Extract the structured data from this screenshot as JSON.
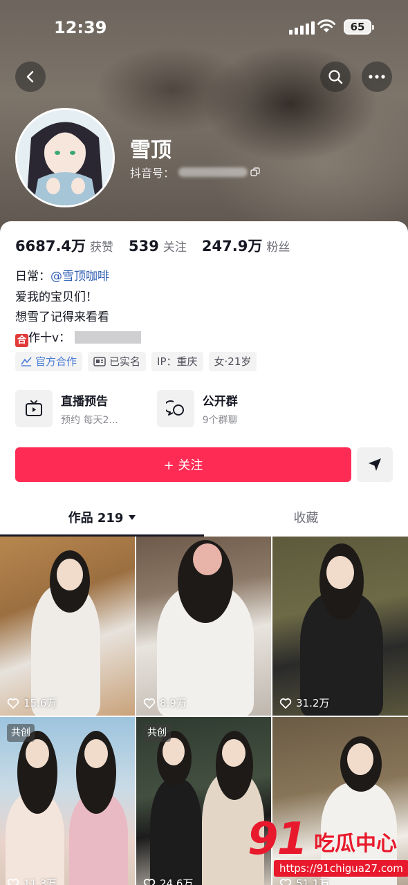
{
  "status_bar": {
    "time": "12:39",
    "battery": "65"
  },
  "profile": {
    "username": "雪顶",
    "douyin_id_label": "抖音号："
  },
  "stats": [
    {
      "num": "6687.4万",
      "label": "获赞"
    },
    {
      "num": "539",
      "label": "关注"
    },
    {
      "num": "247.9万",
      "label": "粉丝"
    }
  ],
  "bio": {
    "line1_prefix": "日常：",
    "line1_mention": "@雪顶咖啡",
    "line2": "爱我的宝贝们！",
    "line3": "想雪了记得来看看",
    "line4_badge": "合",
    "line4_text": "作十v："
  },
  "tags": [
    {
      "label": "官方合作",
      "icon": "official-partner-icon"
    },
    {
      "label": "已实名",
      "icon": "id-card-icon"
    },
    {
      "label": "IP：重庆"
    },
    {
      "label": "女·21岁"
    }
  ],
  "features": [
    {
      "title": "直播预告",
      "sub": "预约 每天2...",
      "icon": "tv-icon"
    },
    {
      "title": "公开群",
      "sub": "9个群聊",
      "icon": "chat-bubbles-icon"
    }
  ],
  "actions": {
    "follow": "+ 关注"
  },
  "tabs": {
    "works": "作品 219",
    "favorites": "收藏"
  },
  "videos": [
    {
      "likes": "15.6万",
      "cocreate": ""
    },
    {
      "likes": "8.9万",
      "cocreate": ""
    },
    {
      "likes": "31.2万",
      "cocreate": ""
    },
    {
      "likes": "11.3万",
      "cocreate": "共创"
    },
    {
      "likes": "24.6万",
      "cocreate": "共创"
    },
    {
      "likes": "51.1万",
      "cocreate": ""
    }
  ],
  "watermark": {
    "brand": "91",
    "text": "吃瓜中心",
    "url": "https://91chigua27.com"
  },
  "colors": {
    "accent": "#fe2c55",
    "mention": "#2f5db2",
    "tag_blue": "#4a7dd6",
    "watermark": "#e8192c"
  }
}
